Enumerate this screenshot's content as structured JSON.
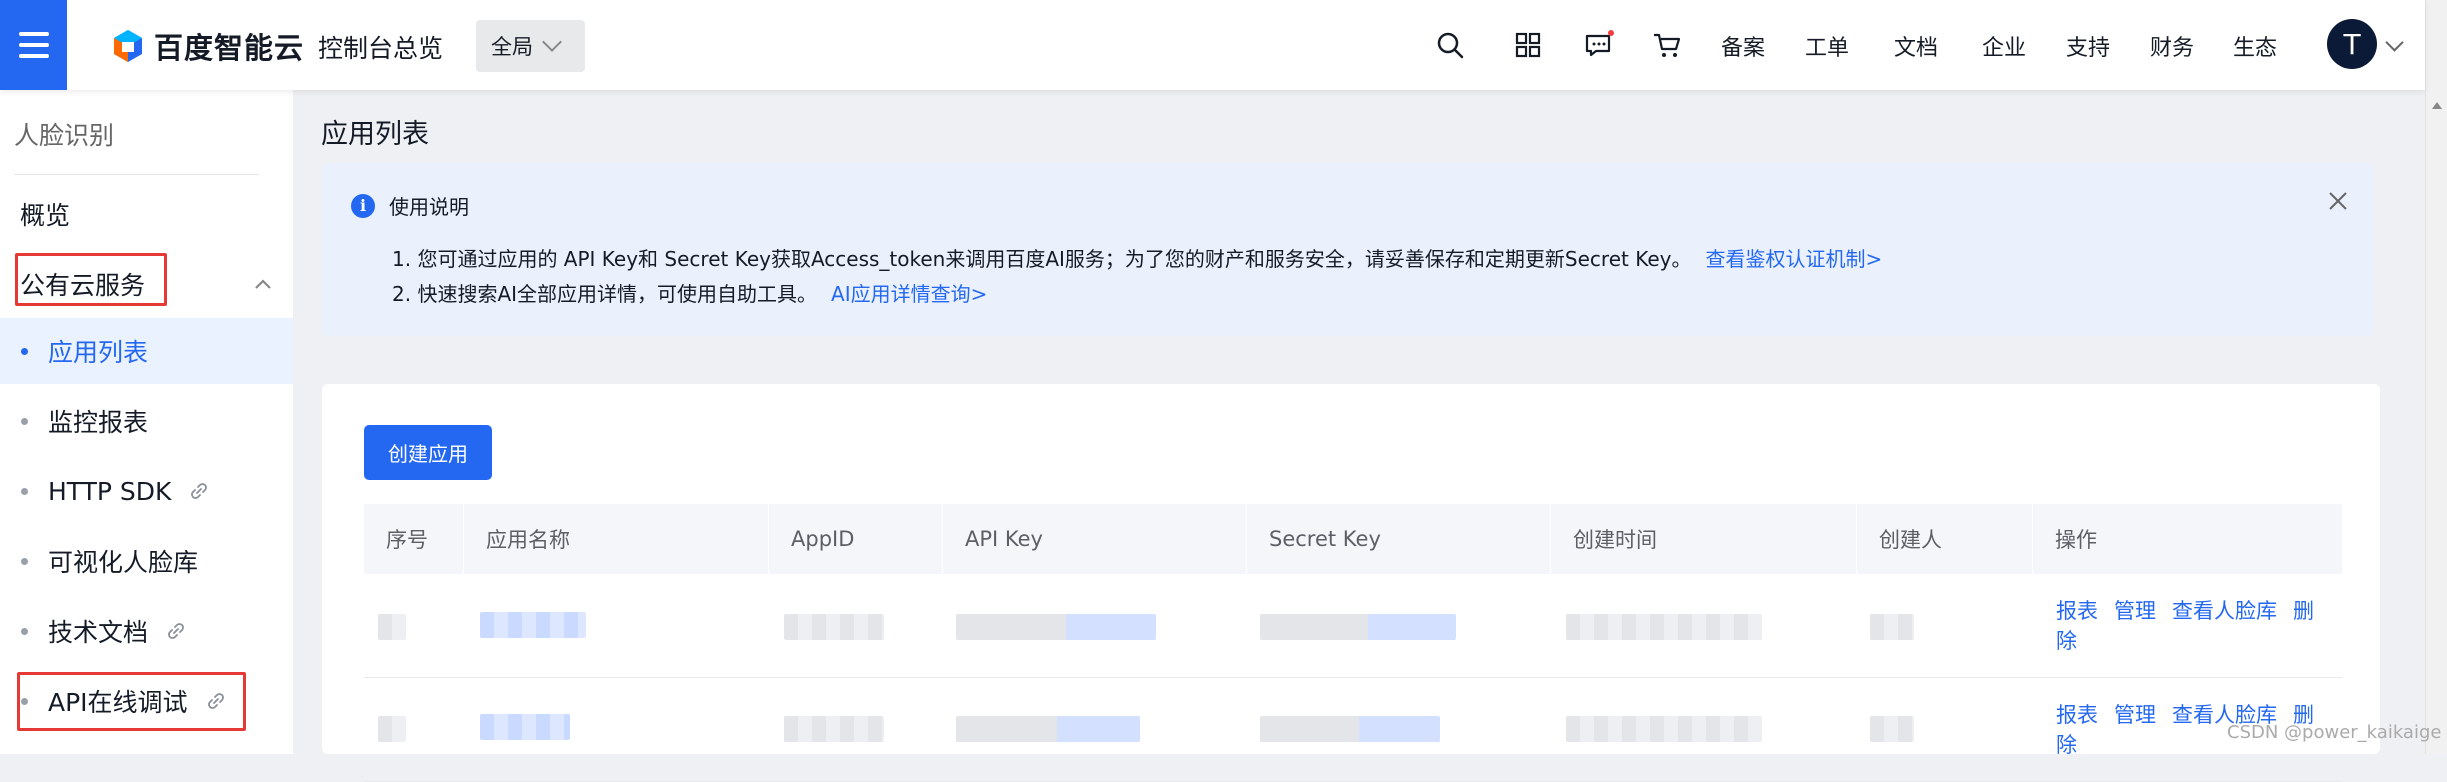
{
  "topbar": {
    "logo_text": "百度智能云",
    "console_label": "控制台总览",
    "scope_label": "全局",
    "nav": [
      "备案",
      "工单",
      "文档",
      "企业",
      "支持",
      "财务",
      "生态"
    ],
    "avatar_letter": "T",
    "icons": [
      "search-icon",
      "grid-icon",
      "message-icon",
      "cart-icon"
    ],
    "accent_color": "#2468f2"
  },
  "sidebar": {
    "title": "人脸识别",
    "overview": "概览",
    "group_label": "公有云服务",
    "items": [
      {
        "label": "应用列表",
        "active": true,
        "external": false
      },
      {
        "label": "监控报表",
        "active": false,
        "external": false
      },
      {
        "label": "HTTP SDK",
        "active": false,
        "external": true
      },
      {
        "label": "可视化人脸库",
        "active": false,
        "external": false
      },
      {
        "label": "技术文档",
        "active": false,
        "external": true
      },
      {
        "label": "API在线调试",
        "active": false,
        "external": true
      }
    ]
  },
  "main": {
    "page_title": "应用列表",
    "notice": {
      "title": "使用说明",
      "line1": "1. 您可通过应用的 API Key和 Secret Key获取Access_token来调用百度AI服务；为了您的财产和服务安全，请妥善保存和定期更新Secret Key。",
      "line1_link": "查看鉴权认证机制>",
      "line2": "2. 快速搜索AI全部应用详情，可使用自助工具。",
      "line2_link": "AI应用详情查询>"
    },
    "create_button": "创建应用",
    "table": {
      "columns": [
        "序号",
        "应用名称",
        "AppID",
        "API Key",
        "Secret Key",
        "创建时间",
        "创建人",
        "操作"
      ],
      "actions": [
        "报表",
        "管理",
        "查看人脸库",
        "删除"
      ]
    }
  },
  "watermark": "CSDN @power_kaikaige"
}
